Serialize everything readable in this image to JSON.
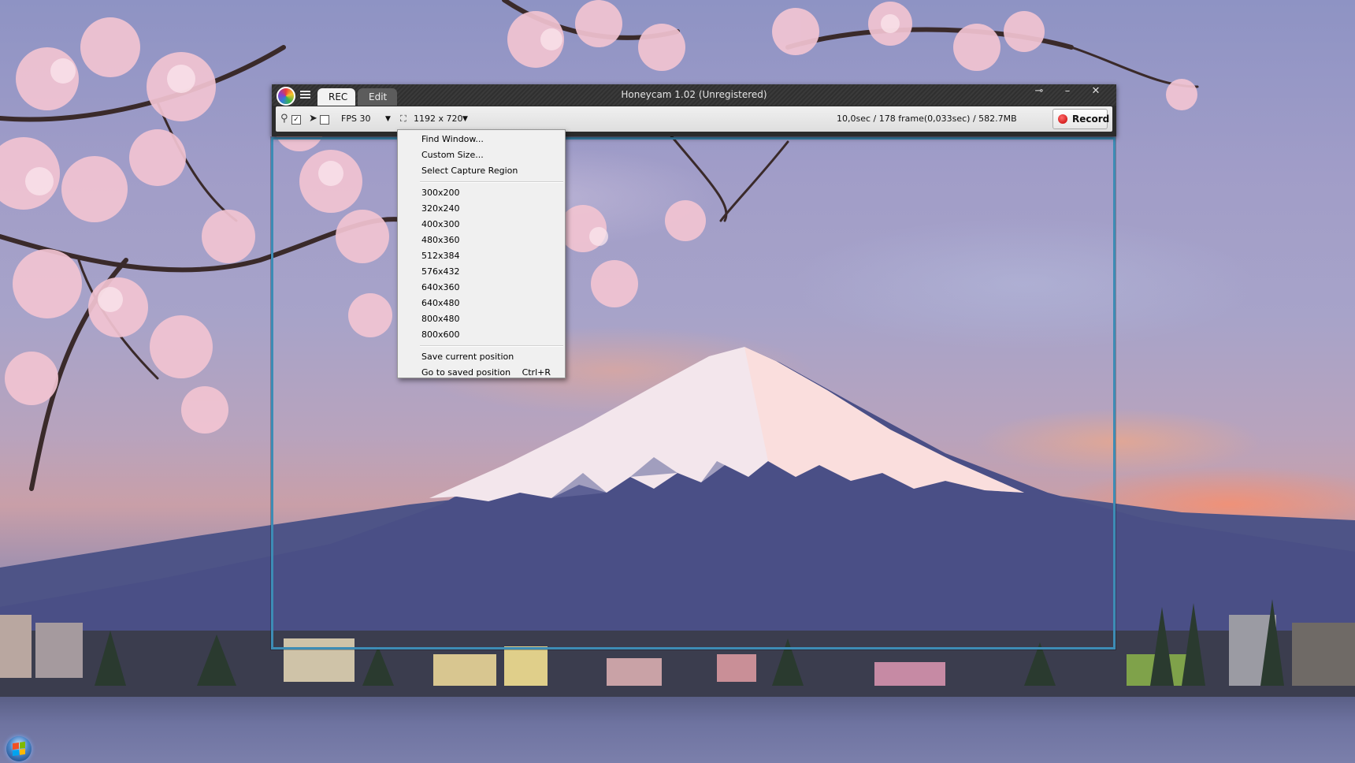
{
  "window": {
    "title": "Honeycam 1.02 (Unregistered)",
    "tabs": [
      "REC",
      "Edit"
    ],
    "active_tab": "REC",
    "minimize_glyph": "–",
    "close_glyph": "✕",
    "pin_glyph": "⊸"
  },
  "toolbar": {
    "pin_checked": true,
    "cursor_checked": false,
    "fps_label": "FPS 30",
    "size_label": "1192 x 720",
    "status": "10,0sec / 178 frame(0,033sec) / 582.7MB",
    "record_label": "Record",
    "dropdown_arrow": "▼",
    "check_glyph": "✓"
  },
  "size_menu": {
    "actions": [
      "Find Window...",
      "Custom Size...",
      "Select Capture Region"
    ],
    "sizes": [
      "300x200",
      "320x240",
      "400x300",
      "480x360",
      "512x384",
      "576x432",
      "640x360",
      "640x480",
      "800x480",
      "800x600"
    ],
    "position_items": [
      {
        "label": "Save current position",
        "shortcut": ""
      },
      {
        "label": "Go to saved position",
        "shortcut": "Ctrl+R"
      }
    ]
  },
  "icons": {
    "logo": "honeycam-logo-icon",
    "menu": "hamburger-menu-icon",
    "pin": "pin-icon",
    "cursor": "mouse-cursor-icon",
    "size": "capture-size-icon",
    "record": "record-dot-icon",
    "start": "windows-start-orb-icon"
  },
  "colors": {
    "capture_frame": "#3d8cb5",
    "record_dot": "#c40000",
    "titlebar": "#2b2b2b"
  }
}
